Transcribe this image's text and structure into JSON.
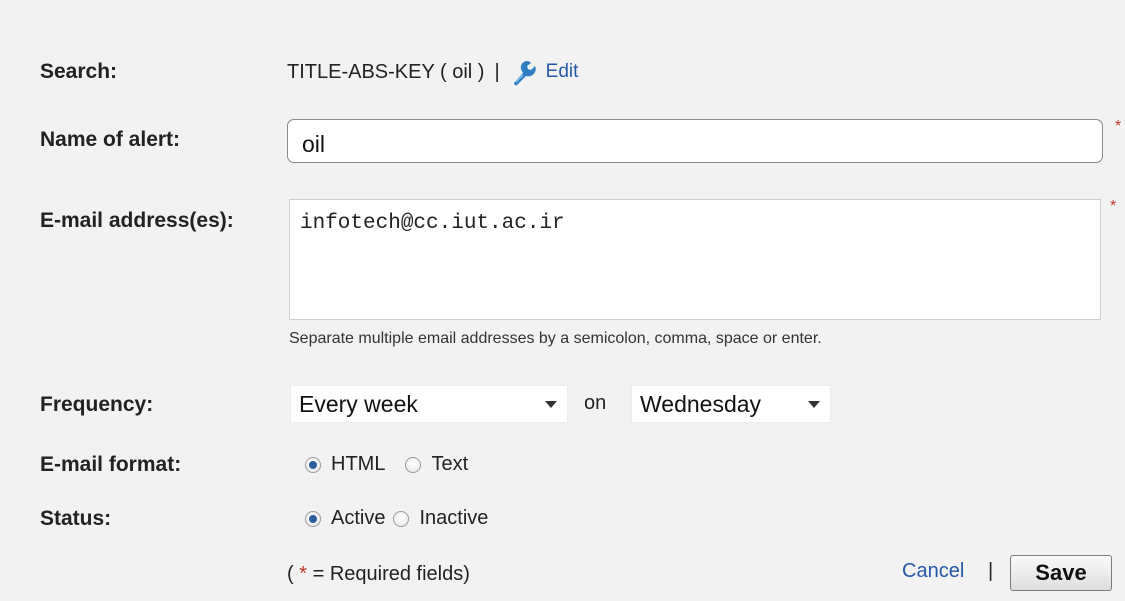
{
  "labels": {
    "search": "Search:",
    "name": "Name of alert:",
    "email": "E-mail address(es):",
    "frequency": "Frequency:",
    "format": "E-mail format:",
    "status": "Status:"
  },
  "search": {
    "query": "TITLE-ABS-KEY ( oil )",
    "separator": "|",
    "edit_label": "Edit"
  },
  "name_field": {
    "value": "oil"
  },
  "email_field": {
    "value": "infotech@cc.iut.ac.ir",
    "hint": "Separate multiple email addresses by a semicolon, comma, space or enter."
  },
  "frequency": {
    "selected": "Every week",
    "on_word": "on",
    "day_selected": "Wednesday"
  },
  "email_format": {
    "options": [
      "HTML",
      "Text"
    ],
    "selected": "HTML"
  },
  "status": {
    "options": [
      "Active",
      "Inactive"
    ],
    "selected": "Active"
  },
  "footer": {
    "required_open": "(",
    "required_star": "*",
    "required_text": "= Required fields)",
    "cancel_label": "Cancel",
    "separator": "|",
    "save_label": "Save"
  },
  "required_marker": "*",
  "colors": {
    "link": "#2559a8",
    "required": "#c0392b",
    "edit_icon": "#2e7fc4"
  },
  "icons": {
    "edit": "edit-wrench-icon",
    "dropdown": "chevron-down-icon"
  }
}
